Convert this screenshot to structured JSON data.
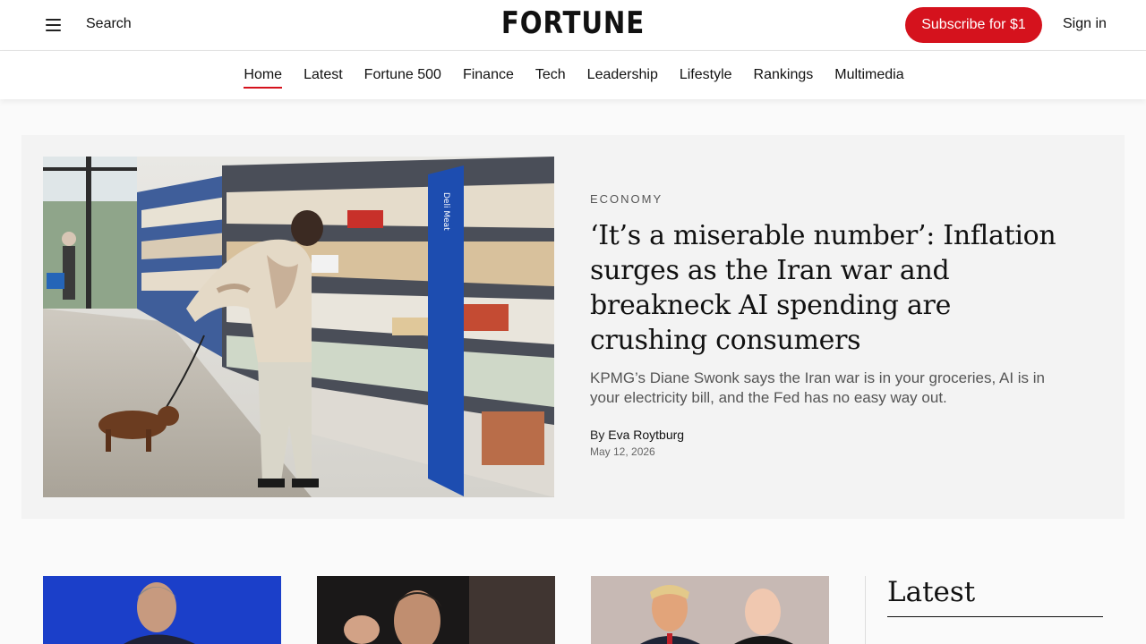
{
  "header": {
    "search_label": "Search",
    "logo_text": "FORTUNE",
    "subscribe_label": "Subscribe for $1",
    "signin_label": "Sign in"
  },
  "nav": {
    "items": [
      "Home",
      "Latest",
      "Fortune 500",
      "Finance",
      "Tech",
      "Leadership",
      "Lifestyle",
      "Rankings",
      "Multimedia"
    ],
    "active": "Home"
  },
  "hero": {
    "kicker": "ECONOMY",
    "headline": "‘It’s a miserable number’: Inflation surges as the Iran war and breakneck AI spending are crushing consumers",
    "dek": "KPMG’s Diane Swonk says the Iran war is in your groceries, AI is in your electricity bill, and the Fed has no easy way out.",
    "byline_prefix": "By",
    "author": "Eva Roytburg",
    "date": "May 12, 2026",
    "shelf_sign": "Deli Meat"
  },
  "latest": {
    "title": "Latest"
  },
  "colors": {
    "brand_red": "#d5121d",
    "hero_bg": "#f3f3f3",
    "page_bg": "#fafafa"
  }
}
